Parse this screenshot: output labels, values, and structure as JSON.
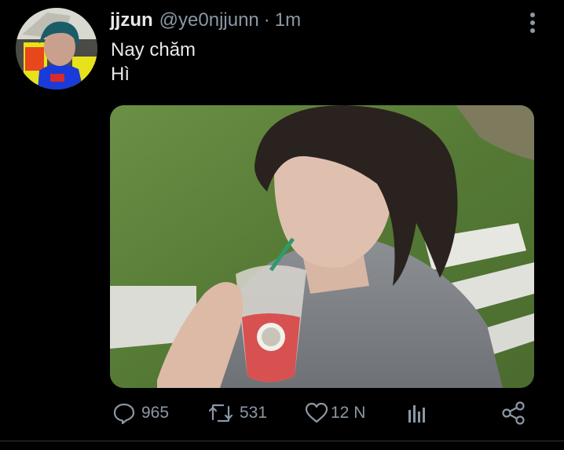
{
  "tweet": {
    "display_name": "jjzun",
    "handle": "@ye0njjunn",
    "separator": "·",
    "time": "1m",
    "lines": [
      "Nay chăm",
      "Hì"
    ]
  },
  "actions": {
    "reply_count": "965",
    "retweet_count": "531",
    "like_count": "12 N"
  },
  "icons": [
    "more-icon",
    "reply-icon",
    "retweet-icon",
    "like-icon",
    "analytics-icon",
    "share-icon"
  ],
  "colors": {
    "background": "#000000",
    "text": "#e7e9ea",
    "muted": "#8b98a5"
  }
}
